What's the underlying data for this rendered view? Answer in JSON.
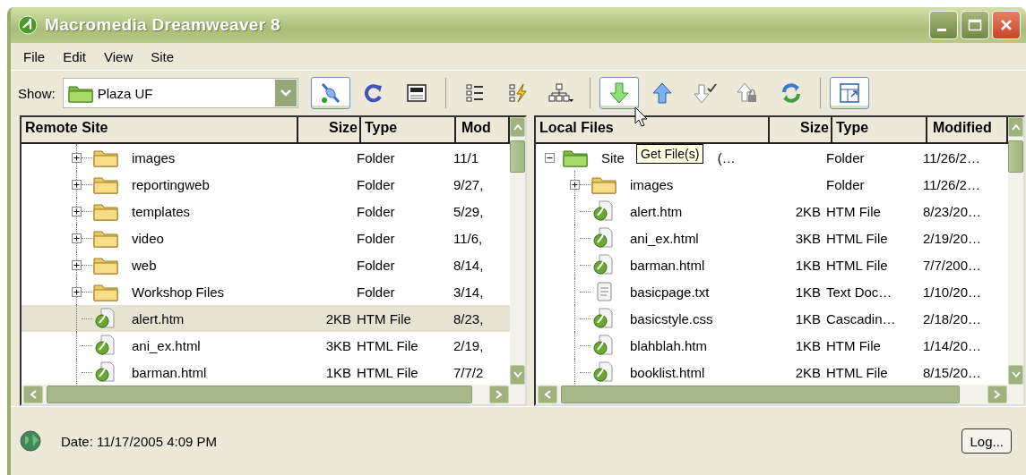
{
  "window": {
    "title": "Macromedia Dreamweaver 8"
  },
  "menu": [
    "File",
    "Edit",
    "View",
    "Site"
  ],
  "toolbar": {
    "show_label": "Show:",
    "site": "Plaza UF",
    "buttons": [
      {
        "kind": "connect",
        "active": true
      },
      {
        "kind": "refresh",
        "active": false
      },
      {
        "kind": "ftp-log",
        "active": false
      },
      {
        "kind": "separator"
      },
      {
        "kind": "site-files",
        "active": false
      },
      {
        "kind": "testing-server",
        "active": false
      },
      {
        "kind": "site-map",
        "active": false
      },
      {
        "kind": "separator"
      },
      {
        "kind": "get",
        "active": true
      },
      {
        "kind": "put",
        "active": false
      },
      {
        "kind": "check-out",
        "active": false
      },
      {
        "kind": "check-in",
        "active": false
      },
      {
        "kind": "sync",
        "active": false
      },
      {
        "kind": "separator"
      },
      {
        "kind": "expand",
        "active": true
      }
    ]
  },
  "remote": {
    "columns": [
      "Remote Site",
      "Size",
      "Type",
      "Mod"
    ],
    "rows": [
      {
        "kind": "folder",
        "name": "images",
        "type": "Folder",
        "modified": "11/1",
        "selected": false
      },
      {
        "kind": "folder",
        "name": "reportingweb",
        "type": "Folder",
        "modified": "9/27,",
        "selected": false
      },
      {
        "kind": "folder",
        "name": "templates",
        "type": "Folder",
        "modified": "5/29,",
        "selected": false
      },
      {
        "kind": "folder",
        "name": "video",
        "type": "Folder",
        "modified": "11/6,",
        "selected": false
      },
      {
        "kind": "folder",
        "name": "web",
        "type": "Folder",
        "modified": "8/14,",
        "selected": false
      },
      {
        "kind": "folder",
        "name": "Workshop Files",
        "type": "Folder",
        "modified": "3/14,",
        "selected": false
      },
      {
        "kind": "page",
        "name": "alert.htm",
        "size": "2KB",
        "type": "HTM File",
        "modified": "8/23,",
        "selected": true
      },
      {
        "kind": "page",
        "name": "ani_ex.html",
        "size": "3KB",
        "type": "HTML File",
        "modified": "2/19,",
        "selected": false
      },
      {
        "kind": "page",
        "name": "barman.html",
        "size": "1KB",
        "type": "HTML File",
        "modified": "7/7/2",
        "selected": false
      }
    ]
  },
  "local": {
    "columns": [
      "Local Files",
      "Size",
      "Type",
      "Modified"
    ],
    "root": {
      "kind": "site",
      "name": "Site",
      "name_tail": "(…",
      "type": "Folder",
      "modified": "11/26/2…",
      "expanded": true,
      "children": [
        {
          "kind": "folder",
          "name": "images",
          "type": "Folder",
          "modified": "11/26/2…",
          "selected": false
        },
        {
          "kind": "page",
          "name": "alert.htm",
          "size": "2KB",
          "type": "HTM File",
          "modified": "8/23/20…",
          "selected": false
        },
        {
          "kind": "page",
          "name": "ani_ex.html",
          "size": "3KB",
          "type": "HTML File",
          "modified": "2/19/20…",
          "selected": false
        },
        {
          "kind": "page",
          "name": "barman.html",
          "size": "1KB",
          "type": "HTML File",
          "modified": "7/7/200…",
          "selected": false
        },
        {
          "kind": "text",
          "name": "basicpage.txt",
          "size": "1KB",
          "type": "Text Doc…",
          "modified": "1/10/20…",
          "selected": false
        },
        {
          "kind": "page",
          "name": "basicstyle.css",
          "size": "1KB",
          "type": "Cascadin…",
          "modified": "2/18/20…",
          "selected": false
        },
        {
          "kind": "page",
          "name": "blahblah.htm",
          "size": "1KB",
          "type": "HTM File",
          "modified": "1/14/20…",
          "selected": false
        },
        {
          "kind": "page",
          "name": "booklist.html",
          "size": "2KB",
          "type": "HTML File",
          "modified": "8/15/20…",
          "selected": false
        }
      ]
    }
  },
  "tooltip": "Get File(s)",
  "status_bar": {
    "date": "Date: 11/17/2005 4:09 PM",
    "log_button": "Log..."
  }
}
